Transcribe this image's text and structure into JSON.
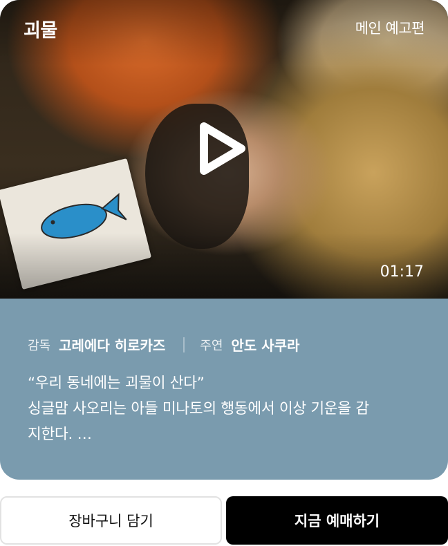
{
  "video": {
    "title": "괴물",
    "label": "메인 예고편",
    "duration": "01:17"
  },
  "credits": {
    "director_label": "감독",
    "director": "고레에다 히로카즈",
    "cast_label": "주연",
    "cast": "안도 사쿠라"
  },
  "description": {
    "lines": [
      "“우리 동네에는 괴물이 산다”",
      "싱글맘 사오리는 아들 미나토의 행동에서 이상 기운을 감",
      "지한다. …"
    ]
  },
  "actions": {
    "cart_label": "장바구니 담기",
    "book_label": "지금 예매하기"
  },
  "colors": {
    "info_panel": "#7a9bae",
    "book_button": "#000000"
  },
  "icons": {
    "play": "play-icon"
  }
}
